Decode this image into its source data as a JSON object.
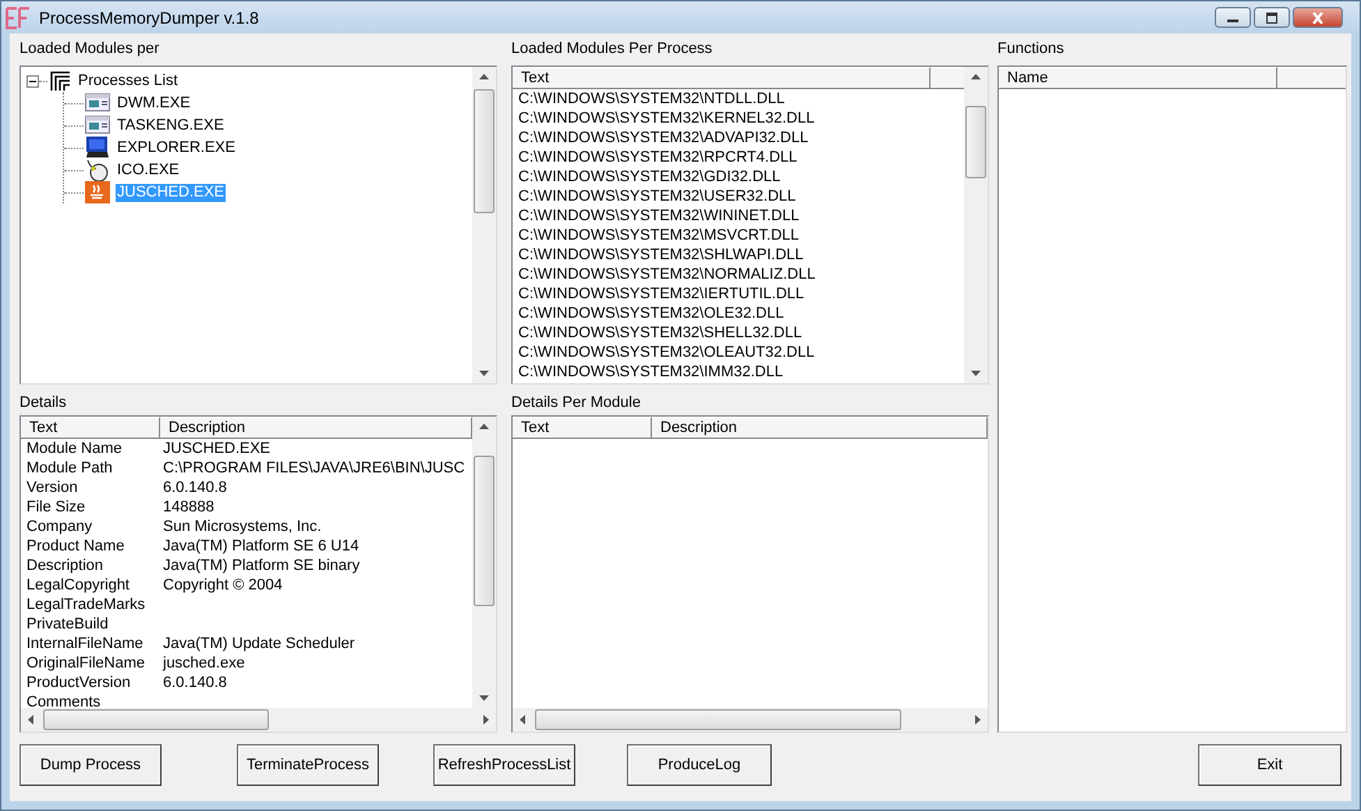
{
  "window": {
    "title": "ProcessMemoryDumper v.1.8"
  },
  "processes": {
    "label": "Loaded Modules per",
    "tree": {
      "label": "Processes List",
      "expanded": true,
      "children": [
        {
          "label": "DWM.EXE",
          "kind": "window",
          "selected": false
        },
        {
          "label": "TASKENG.EXE",
          "kind": "window",
          "selected": false
        },
        {
          "label": "EXPLORER.EXE",
          "kind": "monitor",
          "selected": false
        },
        {
          "label": "ICO.EXE",
          "kind": "mouse",
          "selected": false
        },
        {
          "label": "JUSCHED.EXE",
          "kind": "cup",
          "selected": true
        }
      ]
    }
  },
  "modules": {
    "label": "Loaded Modules Per Process",
    "columns": [
      "Text"
    ],
    "rows": [
      "C:\\WINDOWS\\SYSTEM32\\NTDLL.DLL",
      "C:\\WINDOWS\\SYSTEM32\\KERNEL32.DLL",
      "C:\\WINDOWS\\SYSTEM32\\ADVAPI32.DLL",
      "C:\\WINDOWS\\SYSTEM32\\RPCRT4.DLL",
      "C:\\WINDOWS\\SYSTEM32\\GDI32.DLL",
      "C:\\WINDOWS\\SYSTEM32\\USER32.DLL",
      "C:\\WINDOWS\\SYSTEM32\\WININET.DLL",
      "C:\\WINDOWS\\SYSTEM32\\MSVCRT.DLL",
      "C:\\WINDOWS\\SYSTEM32\\SHLWAPI.DLL",
      "C:\\WINDOWS\\SYSTEM32\\NORMALIZ.DLL",
      "C:\\WINDOWS\\SYSTEM32\\IERTUTIL.DLL",
      "C:\\WINDOWS\\SYSTEM32\\OLE32.DLL",
      "C:\\WINDOWS\\SYSTEM32\\SHELL32.DLL",
      "C:\\WINDOWS\\SYSTEM32\\OLEAUT32.DLL",
      "C:\\WINDOWS\\SYSTEM32\\IMM32.DLL"
    ]
  },
  "functions": {
    "label": "Functions",
    "columns": [
      "Name"
    ]
  },
  "details": {
    "label": "Details",
    "columns": [
      "Text",
      "Description"
    ],
    "rows": [
      {
        "text": "Module Name",
        "description": "JUSCHED.EXE"
      },
      {
        "text": "Module Path",
        "description": "C:\\PROGRAM FILES\\JAVA\\JRE6\\BIN\\JUSC"
      },
      {
        "text": "Version",
        "description": "6.0.140.8"
      },
      {
        "text": "File Size",
        "description": "148888"
      },
      {
        "text": "Company",
        "description": "Sun Microsystems, Inc."
      },
      {
        "text": "Product Name",
        "description": "Java(TM) Platform SE 6 U14"
      },
      {
        "text": "Description",
        "description": "Java(TM) Platform SE binary"
      },
      {
        "text": "LegalCopyright",
        "description": "Copyright © 2004"
      },
      {
        "text": "LegalTradeMarks"
      },
      {
        "text": "PrivateBuild"
      },
      {
        "text": "InternalFileName",
        "description": "Java(TM) Update Scheduler"
      },
      {
        "text": "OriginalFileName",
        "description": "jusched.exe"
      },
      {
        "text": "ProductVersion",
        "description": "6.0.140.8"
      },
      {
        "text": "Comments"
      }
    ]
  },
  "module_details": {
    "label": "Details Per Module",
    "columns": [
      "Text",
      "Description"
    ]
  },
  "buttons": [
    "Dump Process",
    "TerminateProcess",
    "RefreshProcessList",
    "ProduceLog",
    "Exit"
  ]
}
